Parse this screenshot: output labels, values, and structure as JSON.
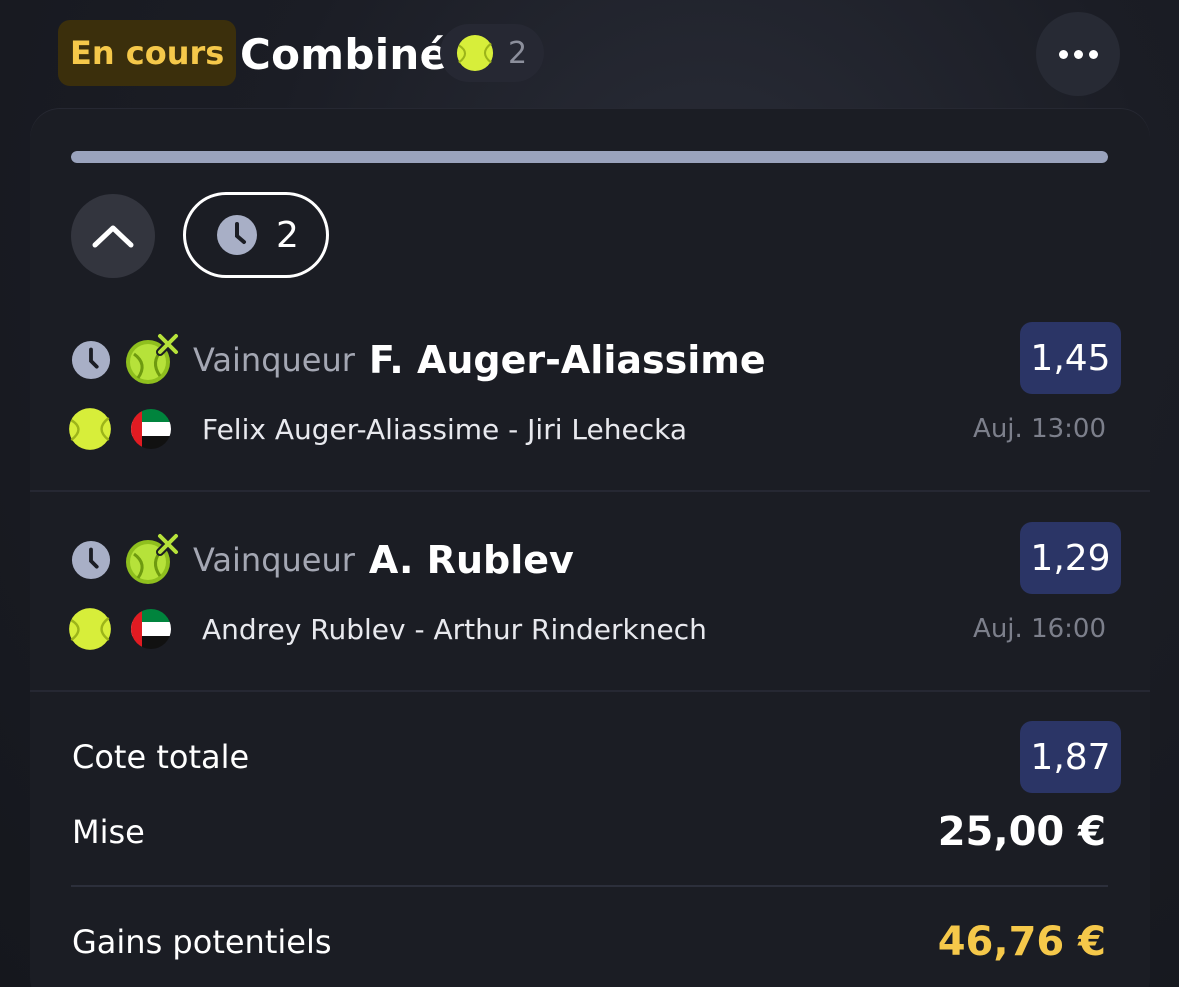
{
  "header": {
    "status": "En cours",
    "title": "Combiné",
    "sport_icon": "tennis-ball-icon",
    "selection_count": "2",
    "more_icon": "more-horizontal-icon"
  },
  "card": {
    "progress": 1.0,
    "pending_icon": "clock-icon",
    "pending_count": "2"
  },
  "selections": [
    {
      "market": "Vainqueur",
      "pick": "F. Auger-Aliassime",
      "odds": "1,45",
      "match": "Felix Auger-Aliassime - Jiri Lehecka",
      "time": "Auj. 13:00",
      "sport_icon": "tennis-ball-icon",
      "flag_icon": "uae-flag-icon"
    },
    {
      "market": "Vainqueur",
      "pick": "A. Rublev",
      "odds": "1,29",
      "match": "Andrey Rublev - Arthur Rinderknech",
      "time": "Auj. 16:00",
      "sport_icon": "tennis-ball-icon",
      "flag_icon": "uae-flag-icon"
    }
  ],
  "summary": {
    "total_odds_label": "Cote totale",
    "total_odds": "1,87",
    "stake_label": "Mise",
    "stake": "25,00 €",
    "potential_win_label": "Gains potentiels",
    "potential_win": "46,76 €"
  },
  "colors": {
    "accent_yellow": "#f5c84a",
    "odds_bg": "#2b3566",
    "boost_green": "#b6e23a"
  }
}
